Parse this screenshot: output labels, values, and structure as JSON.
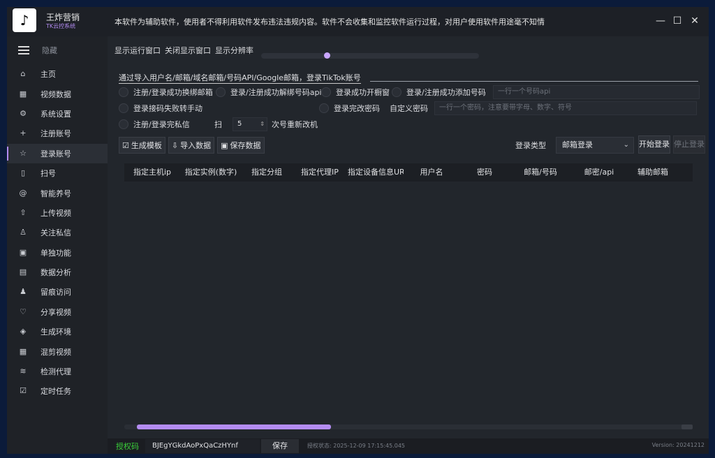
{
  "app": {
    "name": "王炸营销",
    "subtitle": "TK云控系统",
    "notice": "本软件为辅助软件，使用者不得利用软件发布违法违规内容。软件不会收集和监控软件运行过程，对用户使用软件用途毫不知情",
    "controls": {
      "minimize": "—",
      "maximize": "☐",
      "close": "✕"
    }
  },
  "sidebar": {
    "hide_label": "隐藏",
    "items": [
      {
        "label": "主页",
        "icon": "home-icon",
        "glyph": "⌂"
      },
      {
        "label": "视频数据",
        "icon": "film-icon",
        "glyph": "▦"
      },
      {
        "label": "系统设置",
        "icon": "gear-icon",
        "glyph": "⚙"
      },
      {
        "label": "注册账号",
        "icon": "plus-icon",
        "glyph": "+"
      },
      {
        "label": "登录账号",
        "icon": "star-icon",
        "glyph": "☆"
      },
      {
        "label": "扫号",
        "icon": "phone-icon",
        "glyph": "▯"
      },
      {
        "label": "智能养号",
        "icon": "at-icon",
        "glyph": "@"
      },
      {
        "label": "上传视频",
        "icon": "cloud-upload-icon",
        "glyph": "⇧"
      },
      {
        "label": "关注私信",
        "icon": "user-plus-icon",
        "glyph": "♙"
      },
      {
        "label": "单独功能",
        "icon": "4k-icon",
        "glyph": "▣"
      },
      {
        "label": "数据分析",
        "icon": "calendar-check-icon",
        "glyph": "▤"
      },
      {
        "label": "留痕访问",
        "icon": "users-icon",
        "glyph": "♟"
      },
      {
        "label": "分享视频",
        "icon": "heart-icon",
        "glyph": "♡"
      },
      {
        "label": "生成环境",
        "icon": "layers-icon",
        "glyph": "◈"
      },
      {
        "label": "混剪视频",
        "icon": "film-icon",
        "glyph": "▦"
      },
      {
        "label": "检测代理",
        "icon": "rss-icon",
        "glyph": "≋"
      },
      {
        "label": "定时任务",
        "icon": "checkbox-icon",
        "glyph": "☑"
      }
    ],
    "active_index": 4
  },
  "top": {
    "show_window": "显示运行窗口",
    "close_window": "关闭显示窗口",
    "resolution": "显示分辨率",
    "resolution_level": 0.3
  },
  "description": "通过导入用户名/邮箱/域名邮箱/号码API/Google邮箱，登录TikTok账号",
  "options": {
    "row1": [
      "注册/登录成功换绑邮箱",
      "登录/注册成功解绑号码api",
      "登录成功开橱窗",
      "登录/注册成功添加号码"
    ],
    "phone_api_placeholder": "一行一个号码api",
    "row2": [
      "登录接码失败转手动",
      "登录完改密码"
    ],
    "custom_password_label": "自定义密码",
    "custom_password_placeholder": "一行一个密码，注意要带字母、数字、符号",
    "row3_option": "注册/登录完私信",
    "scan_label": "扫",
    "scan_value": "5",
    "scan_suffix": "次号重新改机"
  },
  "toolbar": {
    "generate": "生成模板",
    "import": "导入数据",
    "save": "保存数据"
  },
  "login": {
    "type_label": "登录类型",
    "type_value": "邮箱登录",
    "start": "开始登录",
    "stop": "停止登录"
  },
  "table": {
    "columns": [
      "指定主机ip",
      "指定实例(数字)",
      "指定分组",
      "指定代理IP",
      "指定设备信息URL",
      "用户名",
      "密码",
      "邮箱/号码",
      "邮密/api",
      "辅助邮箱"
    ]
  },
  "footer": {
    "auth_label": "授权码",
    "auth_code": "BJEgYGkdAoPxQaCzHYnf",
    "save": "保存",
    "auth_status": "授权状态: 2025-12-09 17:15:45.045",
    "version": "Version: 20241212"
  }
}
